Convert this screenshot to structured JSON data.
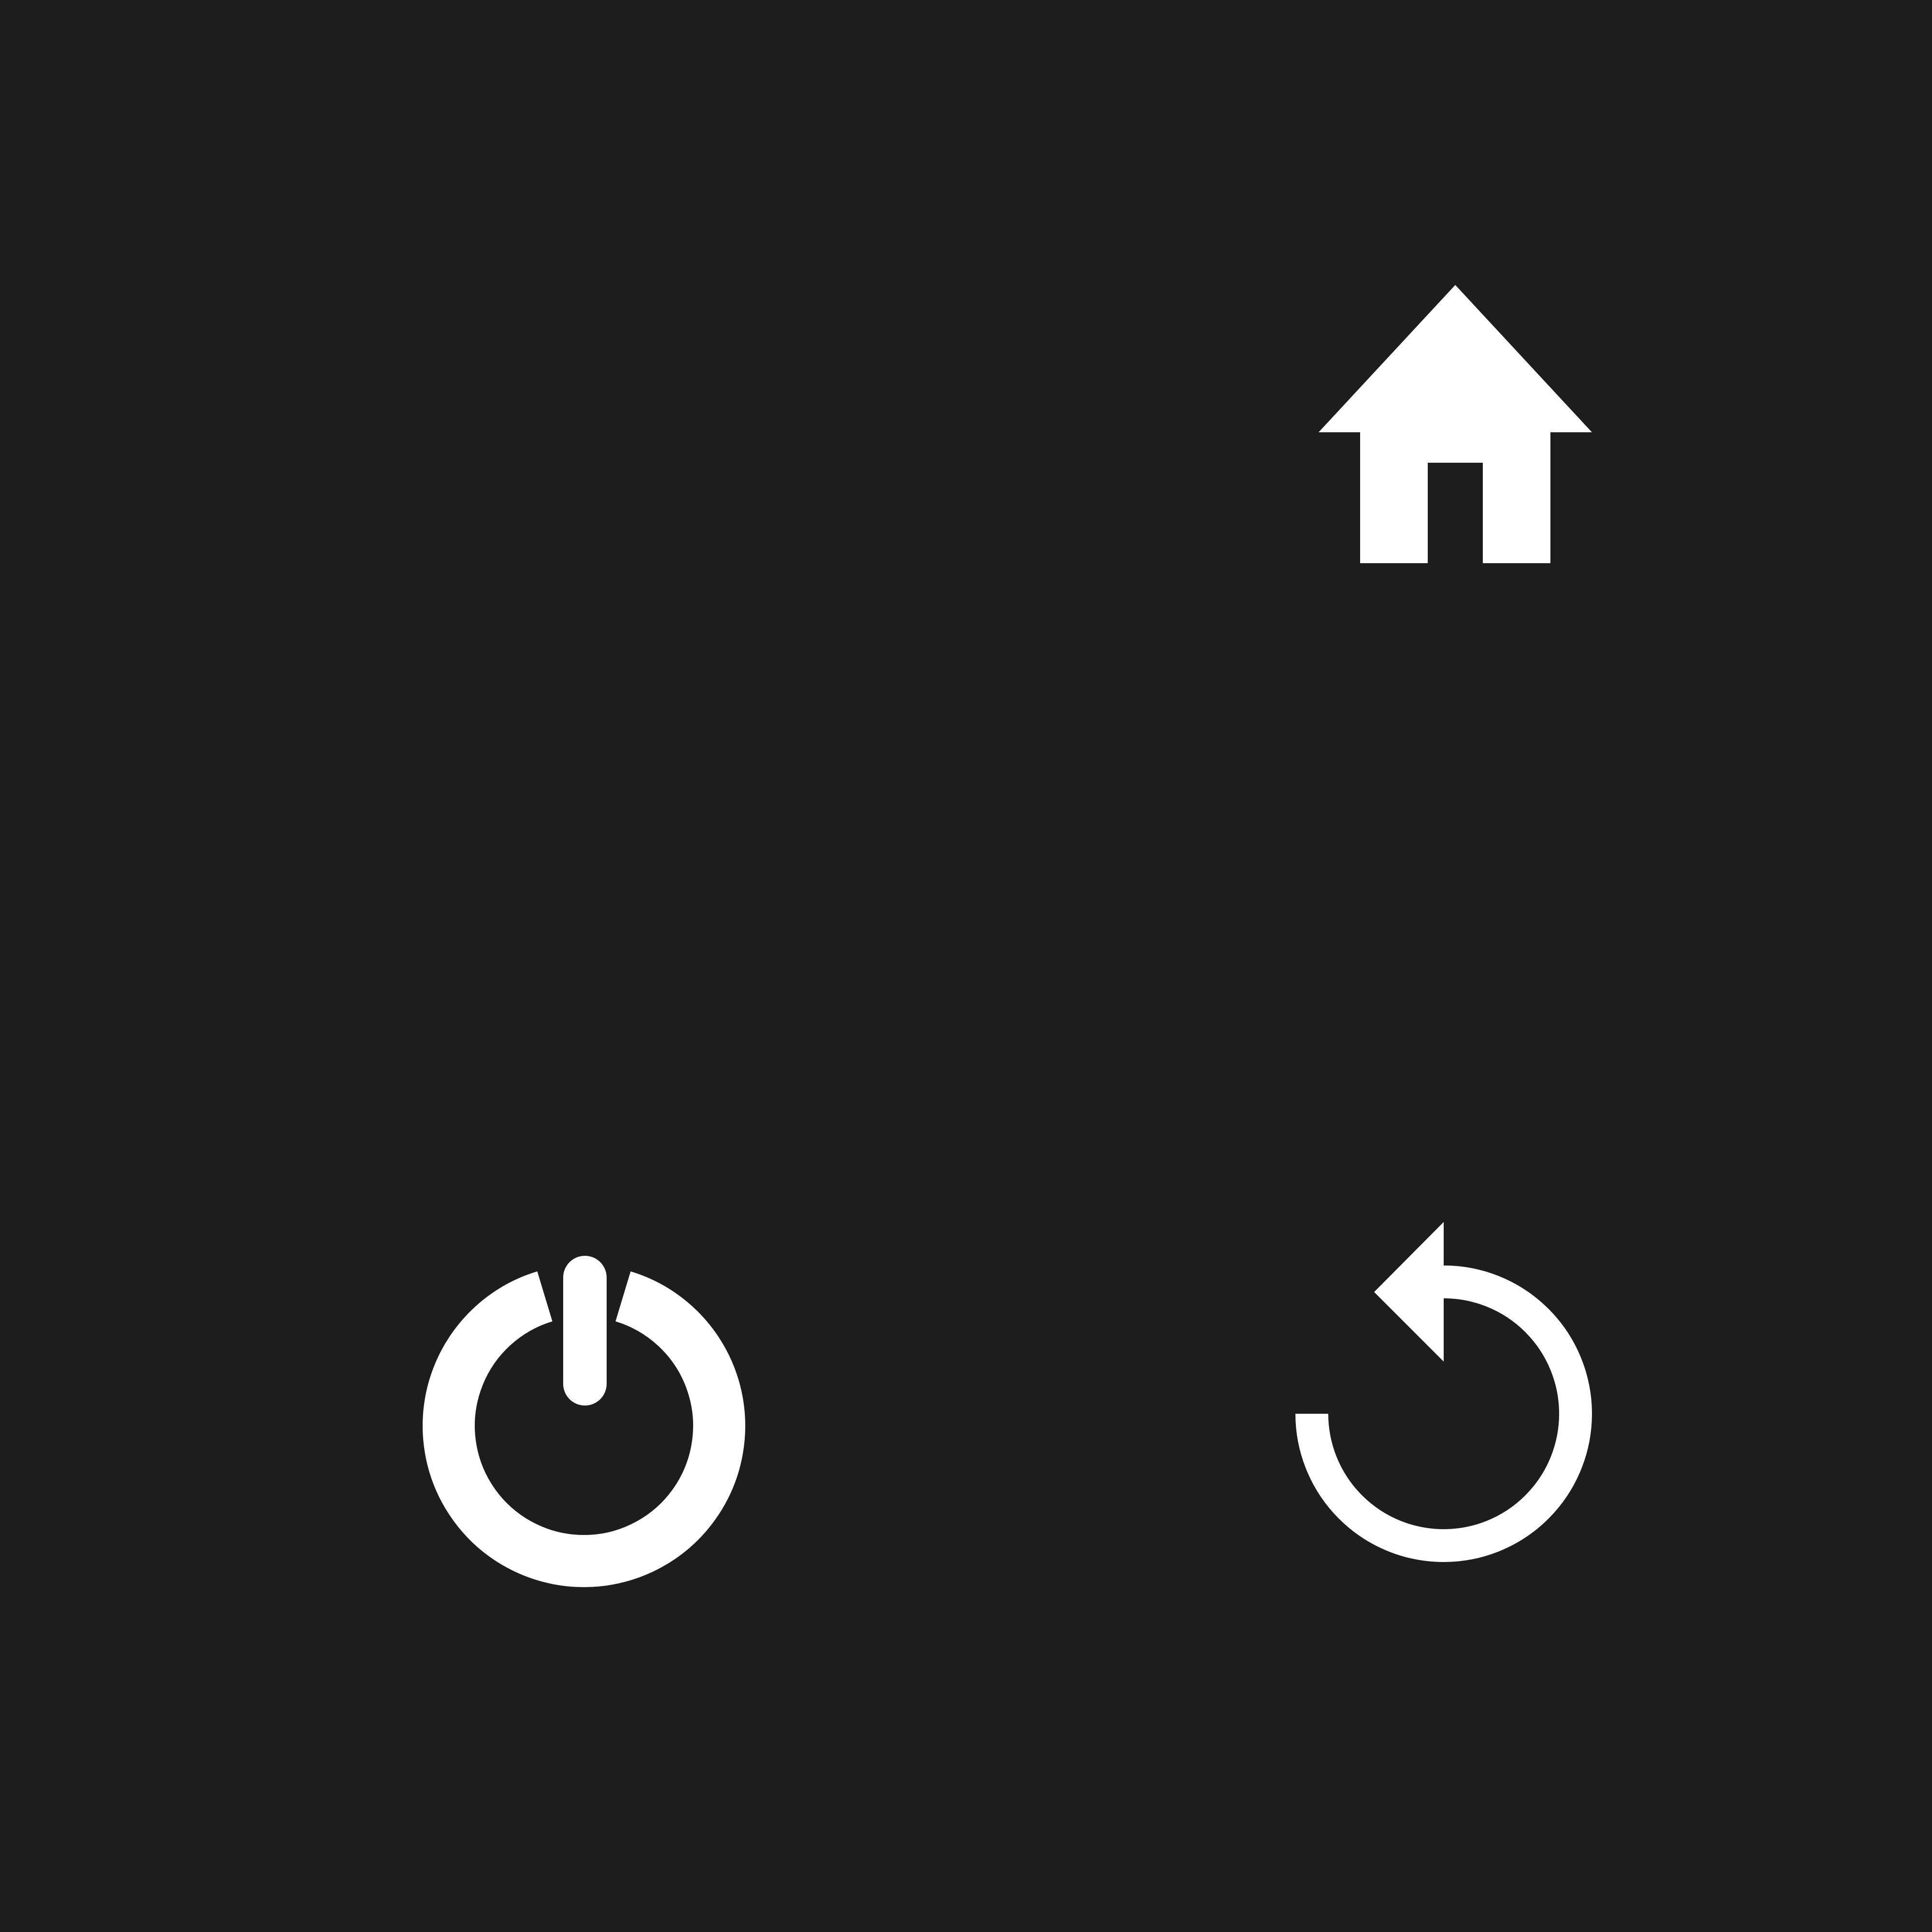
{
  "screen": {
    "background_color": "#1d1d1d",
    "icon_color": "#ffffff"
  },
  "controls": [
    {
      "id": "home",
      "icon": "home-icon"
    },
    {
      "id": "power",
      "icon": "power-icon"
    },
    {
      "id": "reset",
      "icon": "counterclockwise-arrow-icon"
    }
  ]
}
